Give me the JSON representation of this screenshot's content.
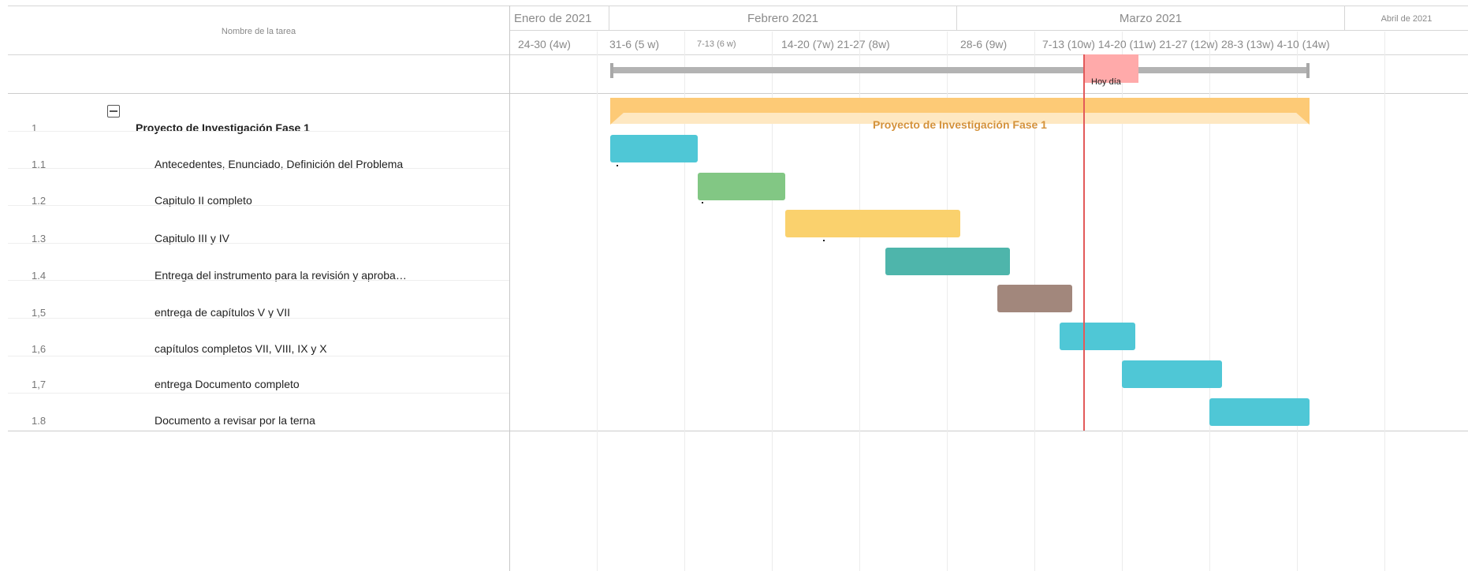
{
  "header": {
    "task_column_label": "Nombre de la tarea",
    "months": [
      {
        "label": "Enero de 2021"
      },
      {
        "label": "Febrero 2021"
      },
      {
        "label": "Marzo 2021"
      },
      {
        "label": "Abril de 2021"
      }
    ],
    "weeks": [
      {
        "label": "24-30 (4w)"
      },
      {
        "label": "31-6 (5 w)"
      },
      {
        "label": "7-13 (6 w)"
      },
      {
        "label": "14-20 (7w) 21-27 (8w)"
      },
      {
        "label": "28-6 (9w)"
      },
      {
        "label": "7-13 (10w) 14-20 (11w) 21-27 (12w) 28-3 (13w) 4-10 (14w)"
      }
    ]
  },
  "today": {
    "label": "Hoy día"
  },
  "project": {
    "id": "1",
    "name": "Proyecto de Investigación  Fase 1",
    "summary_bar_label": "Proyecto de Investigación Fase 1",
    "summary_color": "#fdca76",
    "summary_shadow_color": "#fee8c2"
  },
  "tasks": [
    {
      "id": "1.1",
      "name": "Antecedentes, Enunciado, Definición del Problema",
      "color": "#4fc7d6"
    },
    {
      "id": "1.2",
      "name": "Capitulo II completo",
      "color": "#82c784"
    },
    {
      "id": "1.3",
      "name": "Capitulo III y IV",
      "color": "#fad16d"
    },
    {
      "id": "1.4",
      "name": "Entrega del instrumento para la revisión y aproba…",
      "color": "#4eb5ab"
    },
    {
      "id": "1,5",
      "name": "entrega de capítulos V y VII",
      "color": "#a2877c"
    },
    {
      "id": "1,6",
      "name": "capítulos completos VII, VIII, IX y X",
      "color": "#4fc7d6"
    },
    {
      "id": "1,7",
      "name": "entrega Documento completo",
      "color": "#4fc7d6"
    },
    {
      "id": "1.8",
      "name": "Documento a revisar por la terna",
      "color": "#4fc7d6"
    }
  ],
  "colors": {
    "today_line": "#e35a5a",
    "today_marker": "#ffaaaa",
    "timeline_bar": "#b3b3b3"
  }
}
